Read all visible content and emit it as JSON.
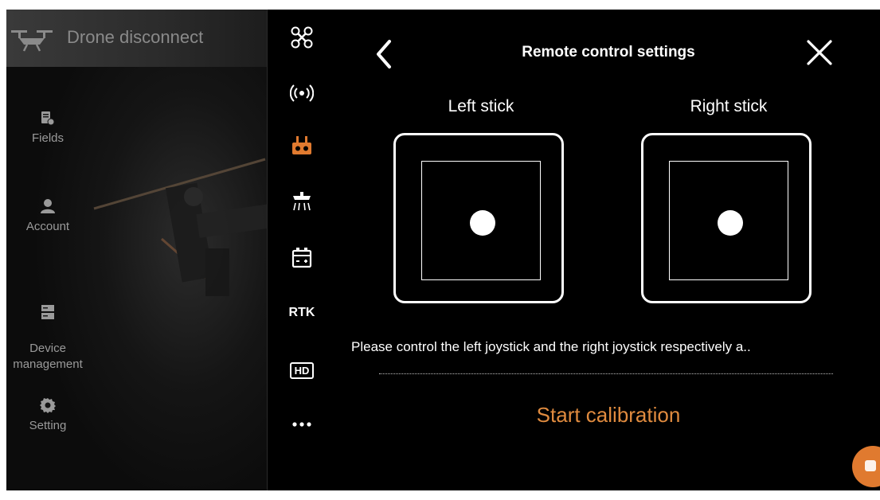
{
  "status": {
    "drone_label": "Drone disconnect"
  },
  "nav": {
    "items": [
      {
        "label": "Fields",
        "icon": "fields-icon"
      },
      {
        "label": "Account",
        "icon": "account-icon"
      },
      {
        "label": "Device\nmanagement",
        "icon": "device-icon"
      },
      {
        "label": "Setting",
        "icon": "gear-icon"
      }
    ]
  },
  "rail": {
    "items": [
      "drone-icon",
      "signal-icon",
      "remote-controller-icon",
      "spray-icon",
      "battery-icon",
      "RTK",
      "HD",
      "more-icon"
    ],
    "rtk_label": "RTK",
    "hd_label": "HD",
    "active_color": "#e07a2f"
  },
  "settings": {
    "title": "Remote control settings",
    "left_stick_label": "Left stick",
    "right_stick_label": "Right stick",
    "instruction": "Please control the left joystick and the right joystick respectively a..",
    "calibration_label": "Start calibration",
    "accent_color": "#e08b3f"
  }
}
